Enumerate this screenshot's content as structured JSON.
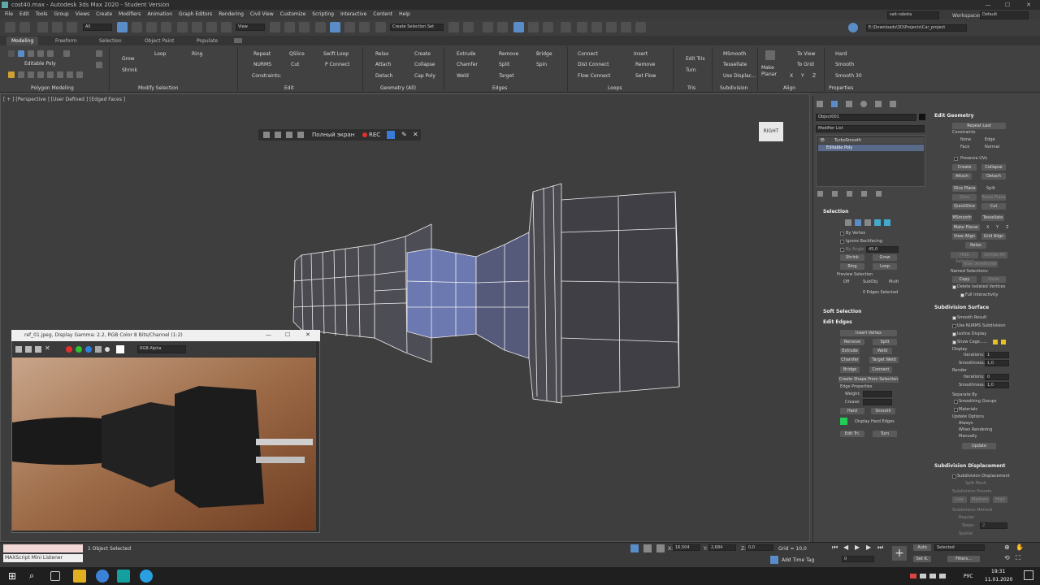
{
  "window": {
    "title": "cost40.max - Autodesk 3ds Max 2020 - Student Version"
  },
  "menu": [
    "File",
    "Edit",
    "Tools",
    "Group",
    "Views",
    "Create",
    "Modifiers",
    "Animation",
    "Graph Editors",
    "Rendering",
    "Civil View",
    "Customize",
    "Scripting",
    "Interactive",
    "Content",
    "Help"
  ],
  "toolbar": {
    "filter_value": "All",
    "view_value": "View",
    "selection_set": "Create Selection Set",
    "user_name": "sait-rabota",
    "workspaces_label": "Workspaces:",
    "workspace_value": "Default",
    "project_path": "E:\\Downloads\\3D\\Projects\\Car_project"
  },
  "ribbon_tabs": [
    "Modeling",
    "Freeform",
    "Selection",
    "Object Paint",
    "Populate"
  ],
  "ribbon": {
    "editable_poly": "Editable Poly",
    "grow": "Grow",
    "shrink": "Shrink",
    "loop": "Loop",
    "ring": "Ring",
    "repeat": "Repeat",
    "qslice": "QSlice",
    "swift_loop": "Swift Loop",
    "nurms": "NURMS",
    "cut": "Cut",
    "p_connect": "P Connect",
    "constraints": "Constraints:",
    "relax": "Relax",
    "create": "Create",
    "attach": "Attach",
    "collapse": "Collapse",
    "detach": "Detach",
    "cap_poly": "Cap Poly",
    "extrude": "Extrude",
    "remove": "Remove",
    "bridge": "Bridge",
    "chamfer": "Chamfer",
    "split": "Split",
    "spin": "Spin",
    "weld": "Weld",
    "target": "Target",
    "connect": "Connect",
    "insert": "Insert",
    "dist_connect": "Dist Connect",
    "remove_loop": "Remove",
    "flow_connect": "Flow Connect",
    "set_flow": "Set Flow",
    "edit_tris": "Edit Tris",
    "turn": "Turn",
    "msmooth": "MSmooth",
    "tessellate": "Tessellate",
    "use_displace": "Use Displac...",
    "make_planar": "Make Planar",
    "to_view": "To View",
    "to_grid": "To Grid",
    "x": "X",
    "y": "Y",
    "z": "Z",
    "hard": "Hard",
    "smooth": "Smooth",
    "smooth30": "Smooth 30",
    "groups": [
      "Polygon Modeling",
      "Modify Selection",
      "Edit",
      "Edges",
      "Geometry (All)",
      "Loops",
      "Tris",
      "Subdivision",
      "Align",
      "Properties"
    ]
  },
  "viewport": {
    "label": "[ + ] [Perspective ] [User Defined ] [Edged Faces ]",
    "fullscreen": "Полный экран",
    "rec": "REC",
    "viewcube": "RIGHT"
  },
  "refwin": {
    "title": "ref_01.jpeg, Display Gamma: 2.2, RGB Color 8 Bits/Channel (1:2)",
    "channel": "RGB Alpha"
  },
  "cmd": {
    "object_name": "Object001",
    "modifier_list": "Modifier List",
    "stack": [
      "TurboSmooth",
      "Editable Poly"
    ],
    "selection": {
      "header": "Selection",
      "by_vertex": "By Vertex",
      "ignore_backfacing": "Ignore Backfacing",
      "by_angle": "By Angle:",
      "angle": "45,0",
      "shrink": "Shrink",
      "grow": "Grow",
      "ring": "Ring",
      "loop": "Loop",
      "preview": "Preview Selection",
      "off": "Off",
      "subobj": "SubObj",
      "multi": "Multi",
      "status": "0 Edges Selected"
    },
    "soft_selection": "Soft Selection",
    "edit_edges": {
      "header": "Edit Edges",
      "insert_vertex": "Insert Vertex",
      "remove": "Remove",
      "split": "Split",
      "extrude": "Extrude",
      "weld": "Weld",
      "chamfer": "Chamfer",
      "target_weld": "Target Weld",
      "bridge": "Bridge",
      "connect": "Connect",
      "create_shape": "Create Shape From Selection",
      "edge_props": "Edge Properties",
      "weight": "Weight:",
      "crease": "Crease:",
      "hard": "Hard",
      "smooth": "Smooth",
      "display_hard": "Display Hard Edges",
      "edit_tri": "Edit Tri.",
      "turn": "Turn"
    },
    "edit_geometry": {
      "header": "Edit Geometry",
      "repeat_last": "Repeat Last",
      "constraints": "Constraints",
      "none": "None",
      "edge": "Edge",
      "face": "Face",
      "normal": "Normal",
      "preserve_uvs": "Preserve UVs",
      "create": "Create",
      "collapse": "Collapse",
      "attach": "Attach",
      "detach": "Detach",
      "slice_plane": "Slice Plane",
      "split": "Split",
      "slice": "Slice",
      "reset_plane": "Reset Plane",
      "quickslice": "QuickSlice",
      "cut": "Cut",
      "msmooth": "MSmooth",
      "tessellate": "Tessellate",
      "make_planar": "Make Planar",
      "x": "X",
      "y": "Y",
      "z": "Z",
      "view_align": "View Align",
      "grid_align": "Grid Align",
      "relax": "Relax",
      "hide_selected": "Hide Selected",
      "unhide_all": "Unhide All",
      "hide_unselected": "Hide Unselected",
      "named_sel": "Named Selections:",
      "copy": "Copy",
      "paste": "Paste",
      "delete_isolated": "Delete Isolated Vertices",
      "full_interactivity": "Full Interactivity"
    },
    "subdivision_surface": {
      "header": "Subdivision Surface",
      "smooth_result": "Smooth Result",
      "use_nurms": "Use NURMS Subdivision",
      "isoline": "Isoline Display",
      "show_cage": "Show Cage......",
      "display": "Display",
      "iterations": "Iterations:",
      "iter_val": "1",
      "smoothness": "Smoothness:",
      "smooth_val": "1,0",
      "render": "Render",
      "r_iterations": "Iterations:",
      "r_iter_val": "0",
      "r_smoothness": "Smoothness:",
      "r_smooth_val": "1,0",
      "separate_by": "Separate By",
      "smoothing_groups": "Smoothing Groups",
      "materials": "Materials",
      "update_options": "Update Options",
      "always": "Always",
      "when_rendering": "When Rendering",
      "manually": "Manually",
      "update": "Update"
    },
    "subdivision_displacement": {
      "header": "Subdivision Displacement",
      "subdiv_disp": "Subdivision Displacement",
      "split_mesh": "Split Mesh",
      "presets": "Subdivision Presets",
      "low": "Low",
      "medium": "Medium",
      "high": "High",
      "method": "Subdivision Method",
      "regular": "Regular",
      "steps": "Steps:",
      "steps_val": "2",
      "spatial": "Spatial"
    }
  },
  "status": {
    "maxscript": "MAXScript Mini Listener",
    "selected": "1 Object Selected",
    "x_label": "X:",
    "x_val": "16,504",
    "y_label": "Y:",
    "y_val": "2,684",
    "z_label": "Z:",
    "z_val": "0,0",
    "grid": "Grid = 10,0",
    "add_time_tag": "Add Time Tag",
    "frame": "0",
    "auto": "Auto",
    "selected_dd": "Selected",
    "set_k": "Set K.",
    "filters": "Filters..."
  },
  "taskbar": {
    "lang": "РУС",
    "time": "19:31",
    "date": "11.01.2020"
  },
  "colors": {
    "accent": "#5a8cc8",
    "selection": "#7c8fd0",
    "green": "#22cc55",
    "yellow": "#e8c020"
  }
}
